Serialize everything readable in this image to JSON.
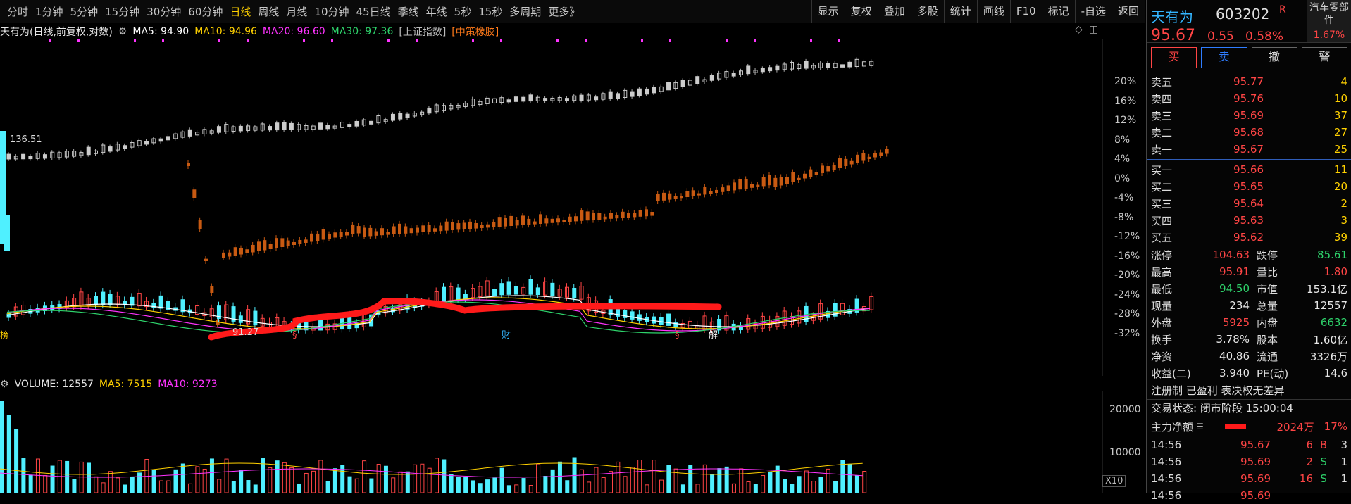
{
  "period_tabs": [
    "分时",
    "1分钟",
    "5分钟",
    "15分钟",
    "30分钟",
    "60分钟",
    "日线",
    "周线",
    "月线",
    "10分钟",
    "45日线",
    "季线",
    "年线",
    "5秒",
    "15秒",
    "多周期",
    "更多》"
  ],
  "active_tab": "日线",
  "toolbar": [
    "显示",
    "复权",
    "叠加",
    "多股",
    "统计",
    "画线",
    "F10",
    "标记",
    "-自选",
    "返回"
  ],
  "legend": {
    "title": "天有为(日线,前复权,对数)",
    "ma5": "MA5: 94.90",
    "ma10": "MA10: 94.96",
    "ma20": "MA20: 96.60",
    "ma30": "MA30: 97.36",
    "index": "[上证指数]",
    "sector": "[中策橡胶]",
    "colors": {
      "ma5": "#ffffff",
      "ma10": "#ffd100",
      "ma20": "#ff33ff",
      "ma30": "#2ed36b",
      "index": "#bbbbbb",
      "sector": "#ff7a1a"
    }
  },
  "price_axis": [
    "20%",
    "16%",
    "12%",
    "8%",
    "4%",
    "0%",
    "-4%",
    "-8%",
    "-12%",
    "-16%",
    "-20%",
    "-24%",
    "-28%",
    "-32%"
  ],
  "chart_labels": {
    "hi_label": "136.51",
    "lo_label": "91.27",
    "event_marks": [
      "§",
      "财",
      "§",
      "解"
    ],
    "left_mark": "榜"
  },
  "volume": {
    "legend_title": "VOLUME: 12557",
    "ma5": "MA5: 7515",
    "ma10": "MA10: 9273",
    "axis": [
      "20000",
      "10000"
    ],
    "unit": "X10"
  },
  "quote": {
    "name": "天有为",
    "code": "603202",
    "mark": "R",
    "price": "95.67",
    "change": "0.55",
    "change_pct": "0.58%",
    "sector_name": "汽车零部件",
    "sector_pct": "1.67%"
  },
  "trade_buttons": [
    "买",
    "卖",
    "撤",
    "警"
  ],
  "asks": [
    {
      "label": "卖五",
      "price": "95.77",
      "qty": "4"
    },
    {
      "label": "卖四",
      "price": "95.76",
      "qty": "10"
    },
    {
      "label": "卖三",
      "price": "95.69",
      "qty": "37"
    },
    {
      "label": "卖二",
      "price": "95.68",
      "qty": "27"
    },
    {
      "label": "卖一",
      "price": "95.67",
      "qty": "25"
    }
  ],
  "bids": [
    {
      "label": "买一",
      "price": "95.66",
      "qty": "11"
    },
    {
      "label": "买二",
      "price": "95.65",
      "qty": "20"
    },
    {
      "label": "买三",
      "price": "95.64",
      "qty": "2"
    },
    {
      "label": "买四",
      "price": "95.63",
      "qty": "3"
    },
    {
      "label": "买五",
      "price": "95.62",
      "qty": "39"
    }
  ],
  "stats": [
    {
      "l1": "涨停",
      "v1": "104.63",
      "c1": "red",
      "l2": "跌停",
      "v2": "85.61",
      "c2": "green"
    },
    {
      "l1": "最高",
      "v1": "95.91",
      "c1": "red",
      "l2": "量比",
      "v2": "1.80",
      "c2": "red"
    },
    {
      "l1": "最低",
      "v1": "94.50",
      "c1": "green",
      "l2": "市值",
      "v2": "153.1亿",
      "c2": "white"
    },
    {
      "l1": "现量",
      "v1": "234",
      "c1": "white",
      "l2": "总量",
      "v2": "12557",
      "c2": "white"
    },
    {
      "l1": "外盘",
      "v1": "5925",
      "c1": "red",
      "l2": "内盘",
      "v2": "6632",
      "c2": "green"
    },
    {
      "l1": "换手",
      "v1": "3.78%",
      "c1": "white",
      "l2": "股本",
      "v2": "1.60亿",
      "c2": "white"
    },
    {
      "l1": "净资",
      "v1": "40.86",
      "c1": "white",
      "l2": "流通",
      "v2": "3326万",
      "c2": "white"
    },
    {
      "l1": "收益(二)",
      "v1": "3.940",
      "c1": "white",
      "l2": "PE(动)",
      "v2": "14.6",
      "c2": "white"
    }
  ],
  "info": {
    "reg": "注册制 已盈利 表决权无差异",
    "status": "交易状态: 闭市阶段 15:00:04"
  },
  "main_flow": {
    "label": "主力净额",
    "amount": "2024万",
    "pct": "17%"
  },
  "ticks": [
    {
      "time": "14:56",
      "price": "95.67",
      "vol": "6",
      "side": "B",
      "n": "3"
    },
    {
      "time": "14:56",
      "price": "95.69",
      "vol": "2",
      "side": "S",
      "n": "1"
    },
    {
      "time": "14:56",
      "price": "95.69",
      "vol": "16",
      "side": "S",
      "n": "1"
    },
    {
      "time": "14:56",
      "price": "95.69",
      "vol": "",
      "side": "",
      "n": ""
    }
  ]
}
